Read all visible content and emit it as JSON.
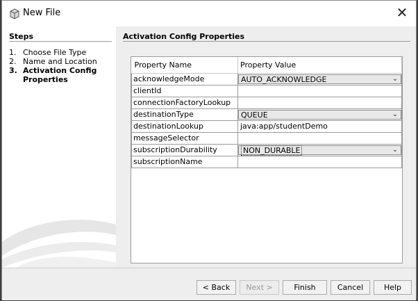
{
  "window": {
    "title": "New File",
    "close_glyph": "✕"
  },
  "steps": {
    "heading": "Steps",
    "items": [
      {
        "num": "1.",
        "label": "Choose File Type",
        "current": false
      },
      {
        "num": "2.",
        "label": "Name and Location",
        "current": false
      },
      {
        "num": "3.",
        "label": "Activation Config Properties",
        "current": true
      }
    ]
  },
  "panel": {
    "title": "Activation Config Properties",
    "columns": [
      "Property Name",
      "Property Value"
    ],
    "rows": [
      {
        "name": "acknowledgeMode",
        "value": "AUTO_ACKNOWLEDGE",
        "kind": "combo"
      },
      {
        "name": "clientId",
        "value": "",
        "kind": "text"
      },
      {
        "name": "connectionFactoryLookup",
        "value": "",
        "kind": "text"
      },
      {
        "name": "destinationType",
        "value": "QUEUE",
        "kind": "combo"
      },
      {
        "name": "destinationLookup",
        "value": "java:app/studentDemo",
        "kind": "text"
      },
      {
        "name": "messageSelector",
        "value": "",
        "kind": "text"
      },
      {
        "name": "subscriptionDurability",
        "value": "NON_DURABLE",
        "kind": "combo"
      },
      {
        "name": "subscriptionName",
        "value": "",
        "kind": "text"
      }
    ]
  },
  "buttons": {
    "back": "< Back",
    "next": "Next >",
    "finish": "Finish",
    "cancel": "Cancel",
    "help": "Help"
  },
  "icons": {
    "window_icon": "cube-icon",
    "dropdown": "chevron-down-icon",
    "close": "close-icon"
  }
}
